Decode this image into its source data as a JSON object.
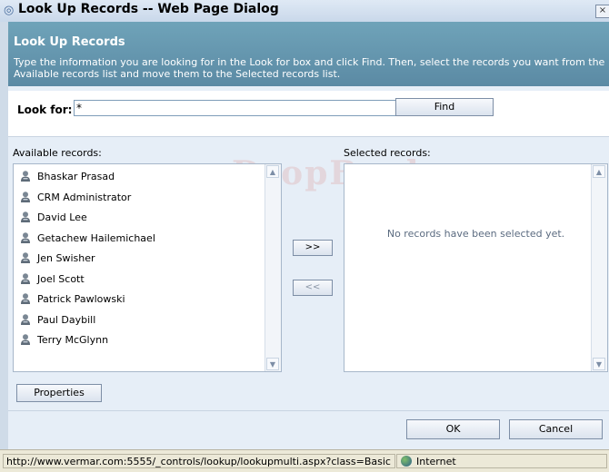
{
  "window": {
    "title": "Look Up Records -- Web Page Dialog",
    "close_glyph": "×"
  },
  "header": {
    "title": "Look Up Records",
    "description": "Type the information you are looking for in the Look for box and click Find. Then, select the records you want from the Available records list and move them to the Selected records list."
  },
  "search": {
    "label": "Look for:",
    "value": "*",
    "find_label": "Find"
  },
  "available": {
    "label": "Available records:",
    "records": [
      "Bhaskar Prasad",
      "CRM Administrator",
      "David Lee",
      "Getachew Hailemichael",
      "Jen Swisher",
      "Joel Scott",
      "Patrick Pawlowski",
      "Paul Daybill",
      "Terry McGlynn"
    ],
    "record_icon": "user-icon"
  },
  "selected": {
    "label": "Selected records:",
    "empty_message": "No records have been selected yet."
  },
  "move": {
    "add_label": ">>",
    "remove_label": "<<"
  },
  "properties_label": "Properties",
  "ok_label": "OK",
  "cancel_label": "Cancel",
  "status": {
    "url": "http://www.vermar.com:5555/_controls/lookup/lookupmulti.aspx?class=Basic",
    "zone": "Internet"
  },
  "watermark": "DropBooks",
  "colors": {
    "header_bg": "#6a9ab2",
    "accent": "#466a9c"
  }
}
